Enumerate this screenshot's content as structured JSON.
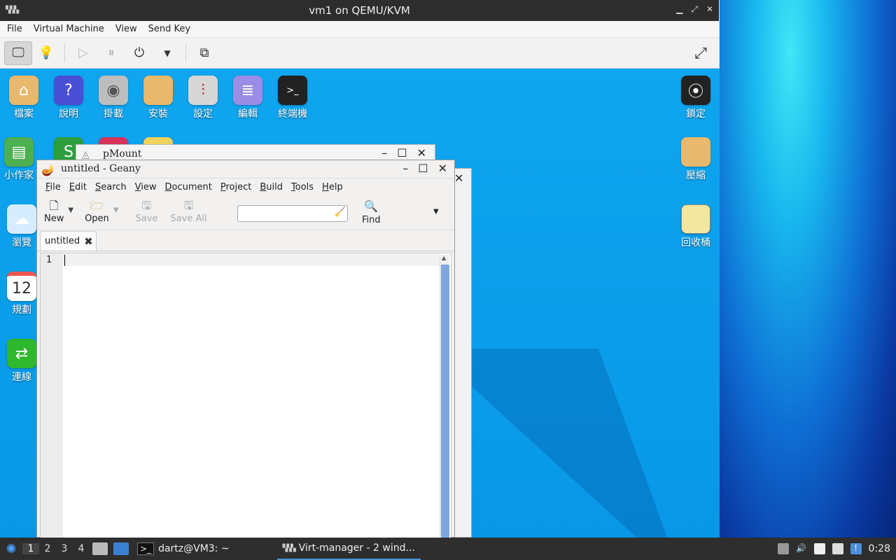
{
  "vm": {
    "title": "vm1 on QEMU/KVM",
    "app_icon": "virt-manager-icon",
    "menu": [
      "File",
      "Virtual Machine",
      "View",
      "Send Key"
    ],
    "toolbar": {
      "console_icon": "monitor-icon",
      "details_icon": "lightbulb-icon",
      "run_icon": "play-icon",
      "pause_icon": "pause-icon",
      "power_icon": "power-icon",
      "power_menu_icon": "chevron-down-icon",
      "screenshot_icon": "screens-icon",
      "fullscreen_icon": "fullscreen-icon"
    }
  },
  "desktop": {
    "top_icons": [
      {
        "label": "檔案",
        "color": "#e8b86c",
        "icon": "home-folder-icon"
      },
      {
        "label": "說明",
        "color": "#4b4fd6",
        "icon": "help-icon"
      },
      {
        "label": "掛載",
        "color": "#aaaaaa",
        "icon": "disk-icon"
      },
      {
        "label": "安裝",
        "color": "#e8b86c",
        "icon": "package-icon"
      },
      {
        "label": "設定",
        "color": "#d0d0d0",
        "icon": "settings-icon"
      },
      {
        "label": "編輯",
        "color": "#9b8ce6",
        "icon": "editor-icon"
      },
      {
        "label": "終端機",
        "color": "#222222",
        "icon": "terminal-icon"
      }
    ],
    "left_icons": [
      {
        "label": "小作家",
        "color": "#4caf50",
        "icon": "writer-icon"
      },
      {
        "label": "瀏覽",
        "color": "#cfe8ff",
        "icon": "cloud-icon"
      },
      {
        "label": "規劃",
        "color": "#ffffff",
        "icon": "calendar-icon",
        "glyph": "12"
      },
      {
        "label": "連線",
        "color": "#2eb82e",
        "icon": "connection-icon"
      }
    ],
    "right_icons": [
      {
        "label": "鎖定",
        "color": "#222222",
        "icon": "lock-icon"
      },
      {
        "label": "壓縮",
        "color": "#e8b86c",
        "icon": "archive-icon"
      },
      {
        "label": "回收桶",
        "color": "#f3e6a0",
        "icon": "trash-folder-icon"
      }
    ]
  },
  "pmount": {
    "title": "pMount"
  },
  "geany": {
    "title": "untitled - Geany",
    "menu": [
      "File",
      "Edit",
      "Search",
      "View",
      "Document",
      "Project",
      "Build",
      "Tools",
      "Help"
    ],
    "toolbar": {
      "new": "New",
      "open": "Open",
      "save": "Save",
      "save_all": "Save All",
      "find": "Find"
    },
    "tab": "untitled",
    "line_number": "1"
  },
  "taskbar": {
    "workspaces": [
      "1",
      "2",
      "3",
      "4"
    ],
    "active_workspace": "1",
    "tasks": [
      {
        "label": "dartz@VM3: ~",
        "icon": "terminal-icon"
      },
      {
        "label": "Virt-manager - 2 wind...",
        "icon": "virt-manager-icon"
      }
    ],
    "clock": "0:28"
  }
}
